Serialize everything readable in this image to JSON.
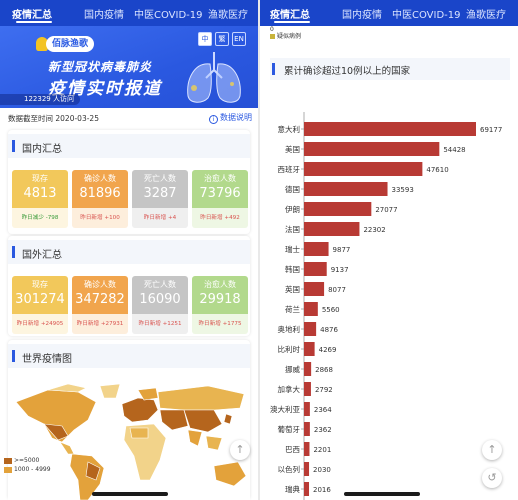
{
  "nav": {
    "tabs": [
      "疫情汇总",
      "国内疫情",
      "中医COVID-19",
      "渔歌医疗"
    ],
    "active_index": 0
  },
  "banner": {
    "brand": "佰脉渔歌",
    "line1": "新型冠状病毒肺炎",
    "line2": "疫情实时报道",
    "languages": [
      "中",
      "繁",
      "EN"
    ],
    "visits": "122329 人访问"
  },
  "date_label": "数据截至时间 2020-03-25",
  "data_note": "数据说明",
  "domestic": {
    "title": "国内汇总",
    "stats": [
      {
        "label": "现存",
        "value": "4813",
        "delta": "昨日减少 -798",
        "top_color": "#f2c85b",
        "bottom_bg": "#fdf5e0",
        "delta_color": "#3a9b3a"
      },
      {
        "label": "确诊人数",
        "value": "81896",
        "delta": "昨日新增 +100",
        "top_color": "#f1a54d",
        "bottom_bg": "#fdeedc",
        "delta_color": "#d9534f"
      },
      {
        "label": "死亡人数",
        "value": "3287",
        "delta": "昨日新增 +4",
        "top_color": "#c5c5c5",
        "bottom_bg": "#efefef",
        "delta_color": "#d9534f"
      },
      {
        "label": "治愈人数",
        "value": "73796",
        "delta": "昨日新增 +492",
        "top_color": "#b2d98c",
        "bottom_bg": "#eef7e4",
        "delta_color": "#d9534f"
      }
    ]
  },
  "overseas": {
    "title": "国外汇总",
    "stats": [
      {
        "label": "现存",
        "value": "301274",
        "delta": "昨日新增 +24905",
        "top_color": "#f2c85b",
        "bottom_bg": "#fdf5e0",
        "delta_color": "#d9534f"
      },
      {
        "label": "确诊人数",
        "value": "347282",
        "delta": "昨日新增 +27931",
        "top_color": "#f1a54d",
        "bottom_bg": "#fdeedc",
        "delta_color": "#d9534f"
      },
      {
        "label": "死亡人数",
        "value": "16090",
        "delta": "昨日新增 +1251",
        "top_color": "#c5c5c5",
        "bottom_bg": "#efefef",
        "delta_color": "#d9534f"
      },
      {
        "label": "治愈人数",
        "value": "29918",
        "delta": "昨日新增 +1775",
        "top_color": "#b2d98c",
        "bottom_bg": "#eef7e4",
        "delta_color": "#d9534f"
      }
    ]
  },
  "world_map": {
    "title": "世界疫情图",
    "legend": [
      {
        "label": ">=5000",
        "color": "#b5651d"
      },
      {
        "label": "1000 - 4999",
        "color": "#e3a23b"
      }
    ]
  },
  "right_top": {
    "top_value": "0",
    "suspect_label": "疑似病例"
  },
  "chart_data": {
    "type": "bar",
    "title": "累计确诊超过10例以上的国家",
    "orientation": "horizontal",
    "color": "#b83a34",
    "categories": [
      "意大利",
      "美国",
      "西班牙",
      "德国",
      "伊朗",
      "法国",
      "瑞士",
      "韩国",
      "英国",
      "荷兰",
      "奥地利",
      "比利时",
      "挪威",
      "加拿大",
      "澳大利亚",
      "葡萄牙",
      "巴西",
      "以色列",
      "瑞典"
    ],
    "values": [
      69177,
      54428,
      47610,
      33593,
      27077,
      22302,
      9877,
      9137,
      8077,
      5560,
      4876,
      4269,
      2868,
      2792,
      2364,
      2362,
      2201,
      2030,
      2016
    ],
    "xlim": [
      0,
      69177
    ]
  }
}
